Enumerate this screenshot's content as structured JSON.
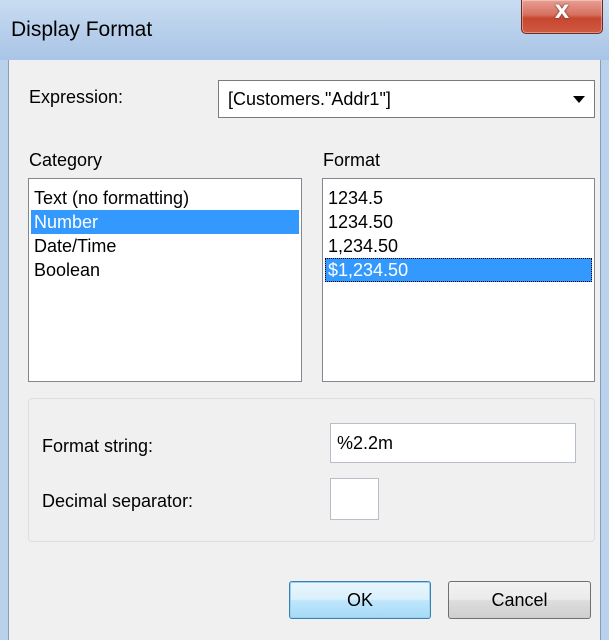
{
  "window": {
    "title": "Display Format",
    "close_glyph": "X"
  },
  "expression": {
    "label": "Expression:",
    "value": "[Customers.\"Addr1\"]"
  },
  "category": {
    "label": "Category",
    "items": [
      {
        "label": "Text (no formatting)",
        "selected": false
      },
      {
        "label": "Number",
        "selected": true
      },
      {
        "label": "Date/Time",
        "selected": false
      },
      {
        "label": "Boolean",
        "selected": false
      }
    ]
  },
  "format": {
    "label": "Format",
    "items": [
      {
        "label": "1234.5",
        "selected": false
      },
      {
        "label": "1234.50",
        "selected": false
      },
      {
        "label": "1,234.50",
        "selected": false
      },
      {
        "label": "$1,234.50",
        "selected": true
      }
    ]
  },
  "format_string": {
    "label": "Format string:",
    "value": "%2.2m"
  },
  "decimal_separator": {
    "label": "Decimal separator:",
    "value": ""
  },
  "buttons": {
    "ok": "OK",
    "cancel": "Cancel"
  },
  "colors": {
    "selection": "#3399ff",
    "titlebar": "#bad1ec",
    "close_button": "#c6472f",
    "default_button_border": "#3c7fb1"
  }
}
